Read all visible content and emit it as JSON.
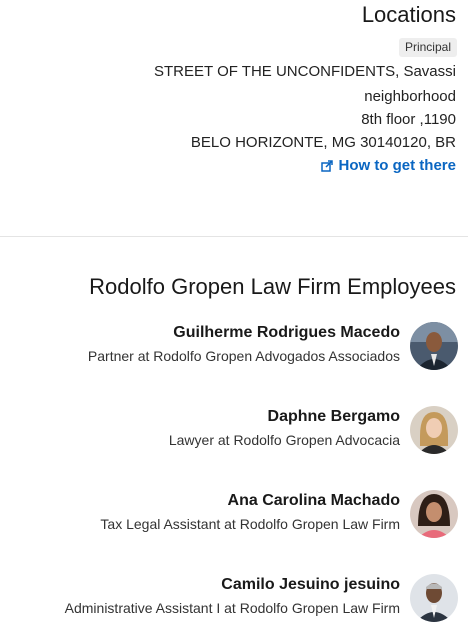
{
  "locations": {
    "title": "Locations",
    "badge": "Principal",
    "address": [
      "STREET OF THE UNCONFIDENTS, Savassi",
      "neighborhood",
      "1190, 8th floor",
      "BELO HORIZONTE, MG 30140120, BR"
    ],
    "directions_label": "How to get there"
  },
  "employees": {
    "title": "Rodolfo Gropen Law Firm Employees",
    "list": [
      {
        "name": "Guilherme Rodrigues Macedo",
        "role": "Partner at Rodolfo Gropen Advogados Associados"
      },
      {
        "name": "Daphne Bergamo",
        "role": "Lawyer at Rodolfo Gropen Advocacia"
      },
      {
        "name": "Ana Carolina Machado",
        "role": "Tax Legal Assistant at Rodolfo Gropen Law Firm"
      },
      {
        "name": "Camilo Jesuino jesuino",
        "role": "Administrative Assistant I at Rodolfo Gropen Law Firm"
      }
    ]
  },
  "colors": {
    "link": "#0a66c2",
    "divider": "#e4e4e4"
  }
}
